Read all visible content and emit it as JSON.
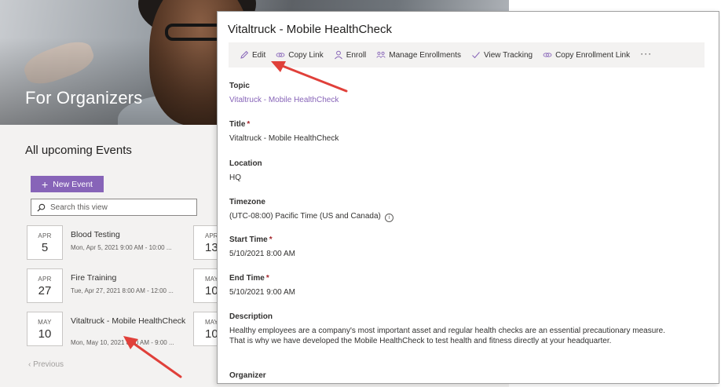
{
  "background": {
    "hero_title": "For Organizers",
    "section_title": "All upcoming Events",
    "new_event_label": "New Event",
    "search_placeholder": "Search this view",
    "events": [
      {
        "month": "APR",
        "day": "5",
        "title": "Blood Testing",
        "subtitle": "Mon, Apr 5, 2021 9:00 AM - 10:00 ..."
      },
      {
        "month": "APR",
        "day": "27",
        "title": "Fire Training",
        "subtitle": "Tue, Apr 27, 2021 8:00 AM - 12:00 ..."
      },
      {
        "month": "MAY",
        "day": "10",
        "title": "Vitaltruck - Mobile HealthCheck",
        "subtitle": "Mon, May 10, 2021 8:00 AM - 9:00 ..."
      }
    ],
    "partial_events": [
      {
        "month": "APR",
        "day": "13"
      },
      {
        "month": "MAY",
        "day": "10"
      },
      {
        "month": "MAY",
        "day": "10"
      }
    ],
    "previous_label": "Previous"
  },
  "panel": {
    "title": "Vitaltruck - Mobile HealthCheck",
    "commands": {
      "edit": "Edit",
      "copy_link": "Copy Link",
      "enroll": "Enroll",
      "manage_enrollments": "Manage Enrollments",
      "view_tracking": "View Tracking",
      "copy_enrollment_link": "Copy Enrollment Link",
      "more": "···"
    },
    "fields": {
      "topic": {
        "label": "Topic",
        "value": "Vitaltruck - Mobile HealthCheck"
      },
      "title": {
        "label": "Title",
        "value": "Vitaltruck - Mobile HealthCheck"
      },
      "location": {
        "label": "Location",
        "value": "HQ"
      },
      "timezone": {
        "label": "Timezone",
        "value": "(UTC-08:00) Pacific Time (US and Canada)"
      },
      "start_time": {
        "label": "Start Time",
        "value": "5/10/2021 8:00 AM"
      },
      "end_time": {
        "label": "End Time",
        "value": "5/10/2021 9:00 AM"
      },
      "description": {
        "label": "Description",
        "line1": "Healthy employees are a company's most important asset and regular health checks are an essential precautionary measure.",
        "line2": "That is why we have developed the Mobile HealthCheck to test health and fitness directly at your headquarter."
      },
      "organizer": {
        "label": "Organizer"
      }
    },
    "required_marker": "*"
  },
  "colors": {
    "accent": "#8764b8",
    "required": "#a4262c",
    "arrow": "#e0403a"
  },
  "icons": [
    "pencil-icon",
    "link-icon",
    "person-icon",
    "people-icon",
    "checkmark-icon",
    "link-icon",
    "search-icon",
    "plus-icon",
    "info-icon",
    "chevron-left-icon"
  ]
}
